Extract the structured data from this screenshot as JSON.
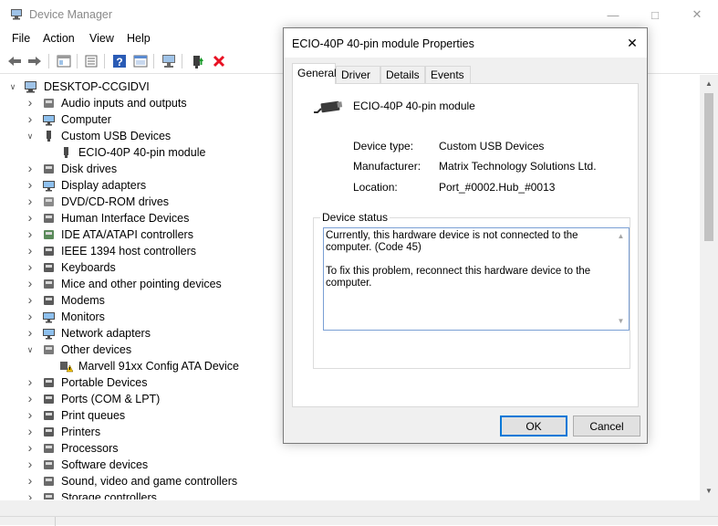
{
  "main_window": {
    "title": "Device Manager",
    "icons": {
      "app": "device-manager-icon",
      "minimize": "minimize-icon",
      "maximize": "maximize-icon",
      "close": "close-icon"
    }
  },
  "menu": [
    "File",
    "Action",
    "View",
    "Help"
  ],
  "toolbar": [
    "back-icon",
    "forward-icon",
    "properties-sheet-icon",
    "properties-icon",
    "help-icon",
    "update-driver-icon",
    "scan-hardware-icon",
    "enable-device-icon",
    "uninstall-device-icon"
  ],
  "tree": {
    "root": "DESKTOP-CCGIDVI",
    "items": [
      {
        "label": "Audio inputs and outputs",
        "icon": "speaker-icon",
        "expanded": false,
        "level": 1
      },
      {
        "label": "Computer",
        "icon": "computer-icon",
        "expanded": false,
        "level": 1
      },
      {
        "label": "Custom USB Devices",
        "icon": "usb-icon",
        "expanded": true,
        "level": 1
      },
      {
        "label": "ECIO-40P 40-pin module",
        "icon": "usb-icon",
        "level": 2
      },
      {
        "label": "Disk drives",
        "icon": "disk-icon",
        "expanded": false,
        "level": 1
      },
      {
        "label": "Display adapters",
        "icon": "display-icon",
        "expanded": false,
        "level": 1
      },
      {
        "label": "DVD/CD-ROM drives",
        "icon": "dvd-icon",
        "expanded": false,
        "level": 1
      },
      {
        "label": "Human Interface Devices",
        "icon": "hid-icon",
        "expanded": false,
        "level": 1
      },
      {
        "label": "IDE ATA/ATAPI controllers",
        "icon": "ide-icon",
        "expanded": false,
        "level": 1
      },
      {
        "label": "IEEE 1394 host controllers",
        "icon": "ieee1394-icon",
        "expanded": false,
        "level": 1
      },
      {
        "label": "Keyboards",
        "icon": "keyboard-icon",
        "expanded": false,
        "level": 1
      },
      {
        "label": "Mice and other pointing devices",
        "icon": "mouse-icon",
        "expanded": false,
        "level": 1
      },
      {
        "label": "Modems",
        "icon": "modem-icon",
        "expanded": false,
        "level": 1
      },
      {
        "label": "Monitors",
        "icon": "monitor-icon",
        "expanded": false,
        "level": 1
      },
      {
        "label": "Network adapters",
        "icon": "network-icon",
        "expanded": false,
        "level": 1
      },
      {
        "label": "Other devices",
        "icon": "other-devices-icon",
        "expanded": true,
        "level": 1
      },
      {
        "label": "Marvell 91xx Config ATA Device",
        "icon": "warning-device-icon",
        "level": 2
      },
      {
        "label": "Portable Devices",
        "icon": "portable-icon",
        "expanded": false,
        "level": 1
      },
      {
        "label": "Ports (COM & LPT)",
        "icon": "port-icon",
        "expanded": false,
        "level": 1
      },
      {
        "label": "Print queues",
        "icon": "printer-icon",
        "expanded": false,
        "level": 1
      },
      {
        "label": "Printers",
        "icon": "printer-icon",
        "expanded": false,
        "level": 1
      },
      {
        "label": "Processors",
        "icon": "processor-icon",
        "expanded": false,
        "level": 1
      },
      {
        "label": "Software devices",
        "icon": "software-icon",
        "expanded": false,
        "level": 1
      },
      {
        "label": "Sound, video and game controllers",
        "icon": "sound-icon",
        "expanded": false,
        "level": 1
      },
      {
        "label": "Storage controllers",
        "icon": "storage-icon",
        "expanded": false,
        "level": 1
      }
    ]
  },
  "dialog": {
    "title": "ECIO-40P 40-pin module Properties",
    "tabs": [
      "General",
      "Driver",
      "Details",
      "Events"
    ],
    "active_tab": "General",
    "device_name": "ECIO-40P 40-pin module",
    "props": [
      {
        "label": "Device type:",
        "value": "Custom USB Devices"
      },
      {
        "label": "Manufacturer:",
        "value": "Matrix Technology Solutions Ltd."
      },
      {
        "label": "Location:",
        "value": "Port_#0002.Hub_#0013"
      }
    ],
    "status_title": "Device status",
    "status_text": "Currently, this hardware device is not connected to the computer. (Code 45)\n\nTo fix this problem, reconnect this hardware device to the computer.",
    "ok_label": "OK",
    "cancel_label": "Cancel"
  },
  "colors": {
    "accent": "#0078d7",
    "warning": "#f5c400",
    "delete": "#e81123",
    "selection_border": "#7a9fd4"
  }
}
